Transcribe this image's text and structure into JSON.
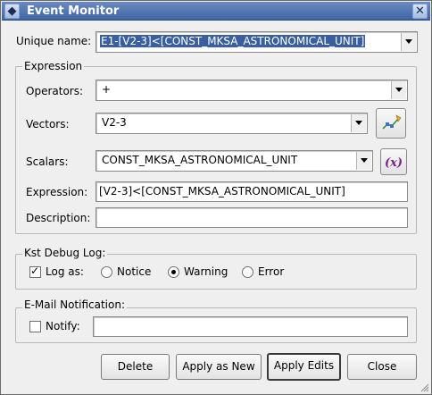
{
  "window": {
    "title": "Event Monitor",
    "icon_glyph": "◆",
    "close_glyph": "✕"
  },
  "unique_name": {
    "label": "Unique name:",
    "value": "E1-[V2-3]<[CONST_MKSA_ASTRONOMICAL_UNIT]"
  },
  "expression_group": {
    "title": "Expression",
    "operators_label": "Operators:",
    "operators_value": "+",
    "vectors_label": "Vectors:",
    "vectors_value": "V2-3",
    "scalars_label": "Scalars:",
    "scalars_value": "CONST_MKSA_ASTRONOMICAL_UNIT",
    "scalar_button_glyph": "(x)",
    "expression_label": "Expression:",
    "expression_value": "[V2-3]<[CONST_MKSA_ASTRONOMICAL_UNIT]",
    "description_label": "Description:",
    "description_value": ""
  },
  "debug_group": {
    "title": "Kst Debug Log:",
    "log_as_label": "Log as:",
    "log_as_checked": true,
    "options": [
      "Notice",
      "Warning",
      "Error"
    ],
    "selected": "Warning",
    "check_glyph": "✓"
  },
  "email_group": {
    "title": "E-Mail Notification:",
    "notify_label": "Notify:",
    "notify_checked": false,
    "notify_value": ""
  },
  "buttons": {
    "delete": "Delete",
    "apply_as_new": "Apply as New",
    "apply_edits": "Apply Edits",
    "close": "Close"
  },
  "colors": {
    "titlebar": "#4a6fae",
    "selection": "#3a5fa0",
    "window_bg": "#efefef"
  }
}
